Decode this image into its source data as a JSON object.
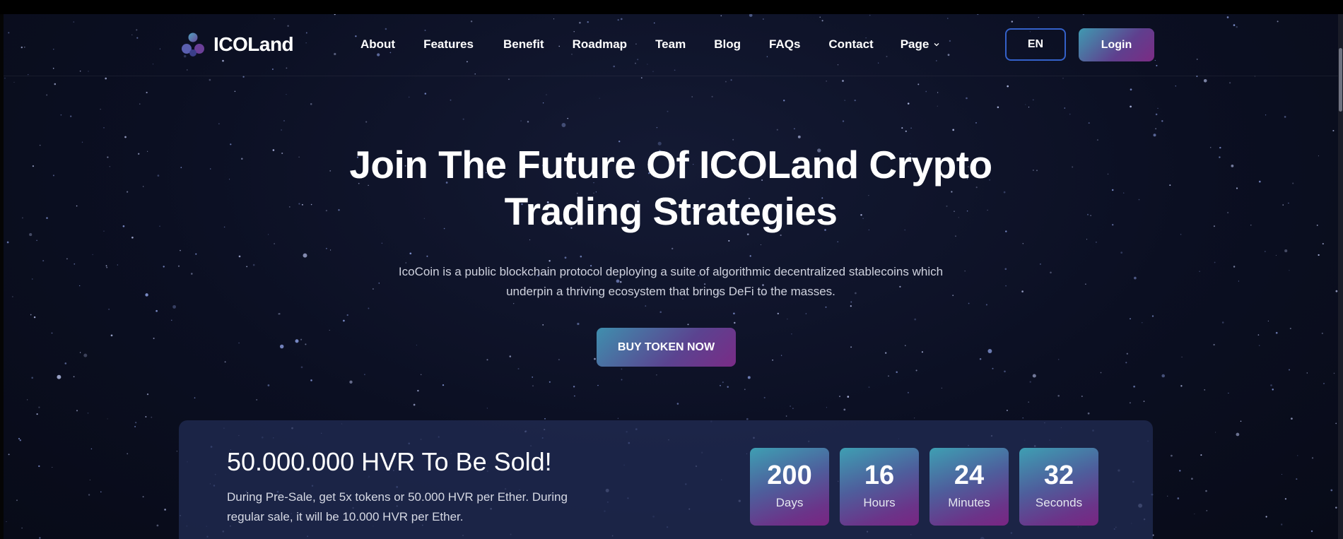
{
  "header": {
    "logo_text": "ICOLand",
    "nav": [
      {
        "label": "About"
      },
      {
        "label": "Features"
      },
      {
        "label": "Benefit"
      },
      {
        "label": "Roadmap"
      },
      {
        "label": "Team"
      },
      {
        "label": "Blog"
      },
      {
        "label": "FAQs"
      },
      {
        "label": "Contact"
      },
      {
        "label": "Page",
        "has_dropdown": true
      }
    ],
    "language_label": "EN",
    "login_label": "Login"
  },
  "hero": {
    "title_line1": "Join The Future Of ICOLand Crypto",
    "title_line2": "Trading Strategies",
    "desc_line1": "IcoCoin is a public blockchain protocol deploying a suite of algorithmic decentralized stablecoins which",
    "desc_line2": "underpin a thriving ecosystem that brings DeFi to the masses.",
    "cta_label": "BUY TOKEN NOW"
  },
  "sale": {
    "title": "50.000.000 HVR To Be Sold!",
    "text_line1": "During Pre-Sale, get 5x tokens or 50.000 HVR per Ether. During",
    "text_line2": "regular sale, it will be 10.000 HVR per Ether.",
    "countdown": [
      {
        "value": "200",
        "label": "Days"
      },
      {
        "value": "16",
        "label": "Hours"
      },
      {
        "value": "24",
        "label": "Minutes"
      },
      {
        "value": "32",
        "label": "Seconds"
      }
    ]
  },
  "colors": {
    "background": "#0b0f22",
    "accent_start": "#3f9ab1",
    "accent_end": "#7c2b84",
    "en_border": "#3461c9"
  },
  "icons": {
    "logo": "icoland-logo-icon",
    "page_dropdown": "chevron-down-icon"
  }
}
